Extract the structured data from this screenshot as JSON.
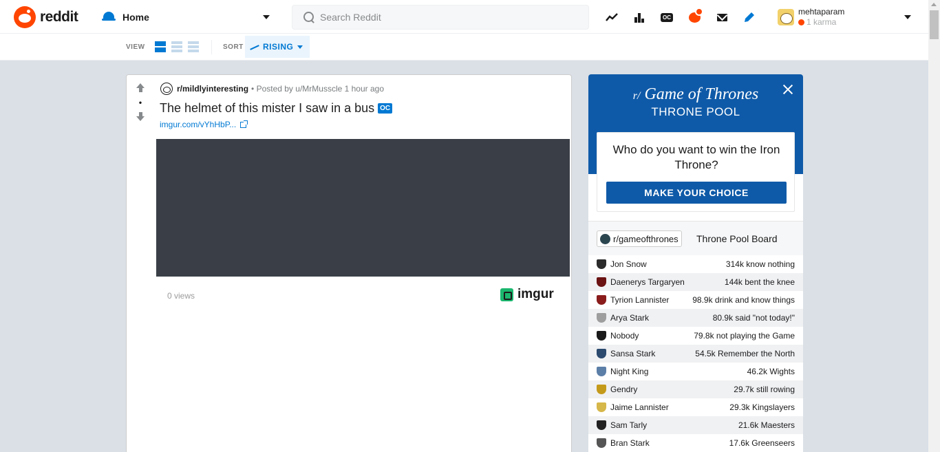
{
  "header": {
    "logo_text": "reddit",
    "home_label": "Home",
    "search_placeholder": "Search Reddit",
    "oc_label": "OC",
    "user": {
      "name": "mehtaparam",
      "karma": "1 karma"
    }
  },
  "sortbar": {
    "view_label": "VIEW",
    "sort_label": "SORT",
    "sort_value": "RISING"
  },
  "post": {
    "subreddit": "r/mildlyinteresting",
    "posted_by": "• Posted by u/MrMusscle 1 hour ago",
    "score": "•",
    "title": "The helmet of this mister I saw in a bus",
    "flair": "OC",
    "link": "imgur.com/vYhHbP...",
    "views": "0 views",
    "imgur_label": "imgur"
  },
  "widget": {
    "title_prefix": "r/",
    "title": "Game of Thrones",
    "subtitle": "THRONE POOL",
    "question": "Who do you want to win the Iron Throne?",
    "button": "MAKE YOUR CHOICE",
    "board_sub": "r/gameofthrones",
    "board_title": "Throne Pool Board",
    "rows": [
      {
        "name": "Jon Snow",
        "stat": "314k know nothing",
        "color": "#2b2b2b"
      },
      {
        "name": "Daenerys Targaryen",
        "stat": "144k bent the knee",
        "color": "#6b1212"
      },
      {
        "name": "Tyrion Lannister",
        "stat": "98.9k drink and know things",
        "color": "#8a1c1c"
      },
      {
        "name": "Arya Stark",
        "stat": "80.9k said \"not today!\"",
        "color": "#9e9e9e"
      },
      {
        "name": "Nobody",
        "stat": "79.8k not playing the Game",
        "color": "#1a1a1a"
      },
      {
        "name": "Sansa Stark",
        "stat": "54.5k Remember the North",
        "color": "#2c4a6e"
      },
      {
        "name": "Night King",
        "stat": "46.2k Wights",
        "color": "#5c7fa8"
      },
      {
        "name": "Gendry",
        "stat": "29.7k still rowing",
        "color": "#c49a1a"
      },
      {
        "name": "Jaime Lannister",
        "stat": "29.3k Kingslayers",
        "color": "#d6b74a"
      },
      {
        "name": "Sam Tarly",
        "stat": "21.6k Maesters",
        "color": "#222222"
      },
      {
        "name": "Bran Stark",
        "stat": "17.6k Greenseers",
        "color": "#555555"
      }
    ]
  },
  "colors": {
    "reddit_orange": "#ff4500",
    "accent_blue": "#0079d3",
    "got_blue": "#0f5aa8",
    "media_bg": "#3a3f47"
  }
}
